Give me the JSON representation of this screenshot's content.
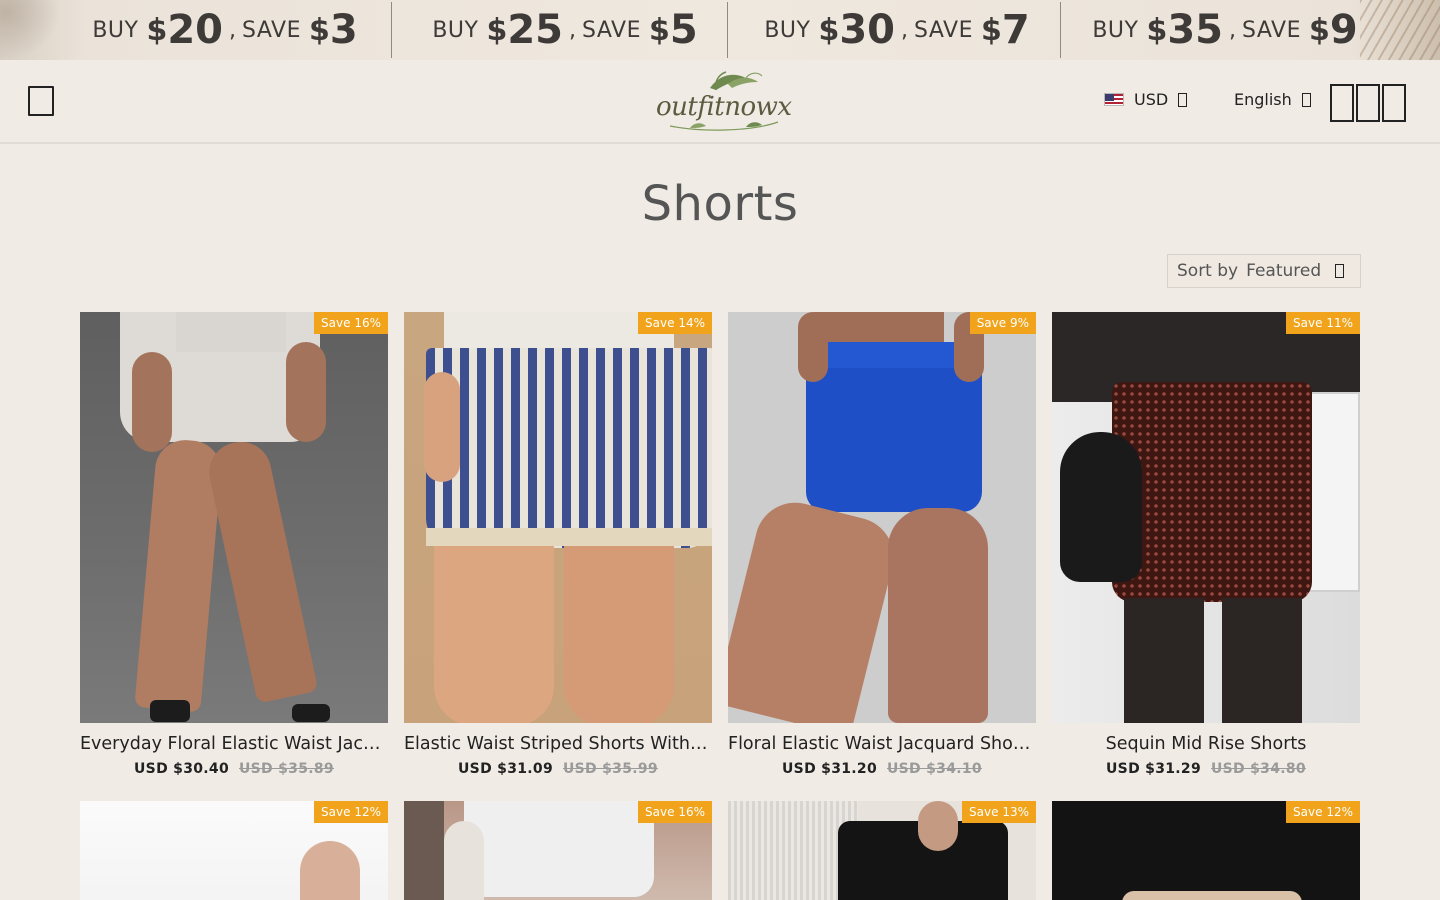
{
  "promo": {
    "segments": [
      {
        "buy": "BUY",
        "buy_cur": "$",
        "buy_amt": "20",
        "save": "SAVE",
        "save_cur": "$",
        "save_amt": "3"
      },
      {
        "buy": "BUY",
        "buy_cur": "$",
        "buy_amt": "25",
        "save": "SAVE",
        "save_cur": "$",
        "save_amt": "5"
      },
      {
        "buy": "BUY",
        "buy_cur": "$",
        "buy_amt": "30",
        "save": "SAVE",
        "save_cur": "$",
        "save_amt": "7"
      },
      {
        "buy": "BUY",
        "buy_cur": "$",
        "buy_amt": "35",
        "save": "SAVE",
        "save_cur": "$",
        "save_amt": "9"
      }
    ],
    "comma": ","
  },
  "header": {
    "logo_text": "outfitnowx",
    "currency": "USD",
    "language": "English",
    "menu_icon": "menu-icon",
    "icons": [
      "search-icon",
      "account-icon",
      "cart-icon"
    ]
  },
  "page": {
    "title": "Shorts"
  },
  "sort": {
    "label": "Sort by",
    "value": "Featured"
  },
  "colors": {
    "badge": "#f0a31b",
    "background": "#f1ebe5"
  },
  "products": [
    {
      "title": "Everyday Floral Elastic Waist Jacquard Shorts",
      "price": "USD $30.40",
      "old_price": "USD $35.89",
      "badge": "Save 16%"
    },
    {
      "title": "Elastic Waist Striped Shorts With Pockets",
      "price": "USD $31.09",
      "old_price": "USD $35.99",
      "badge": "Save 14%"
    },
    {
      "title": "Floral Elastic Waist Jacquard Shorts",
      "price": "USD $31.20",
      "old_price": "USD $34.10",
      "badge": "Save 9%"
    },
    {
      "title": "Sequin Mid Rise Shorts",
      "price": "USD $31.29",
      "old_price": "USD $34.80",
      "badge": "Save 11%"
    }
  ],
  "products_row2": [
    {
      "badge": "Save 12%"
    },
    {
      "badge": "Save 16%"
    },
    {
      "badge": "Save 13%"
    },
    {
      "badge": "Save 12%"
    }
  ]
}
